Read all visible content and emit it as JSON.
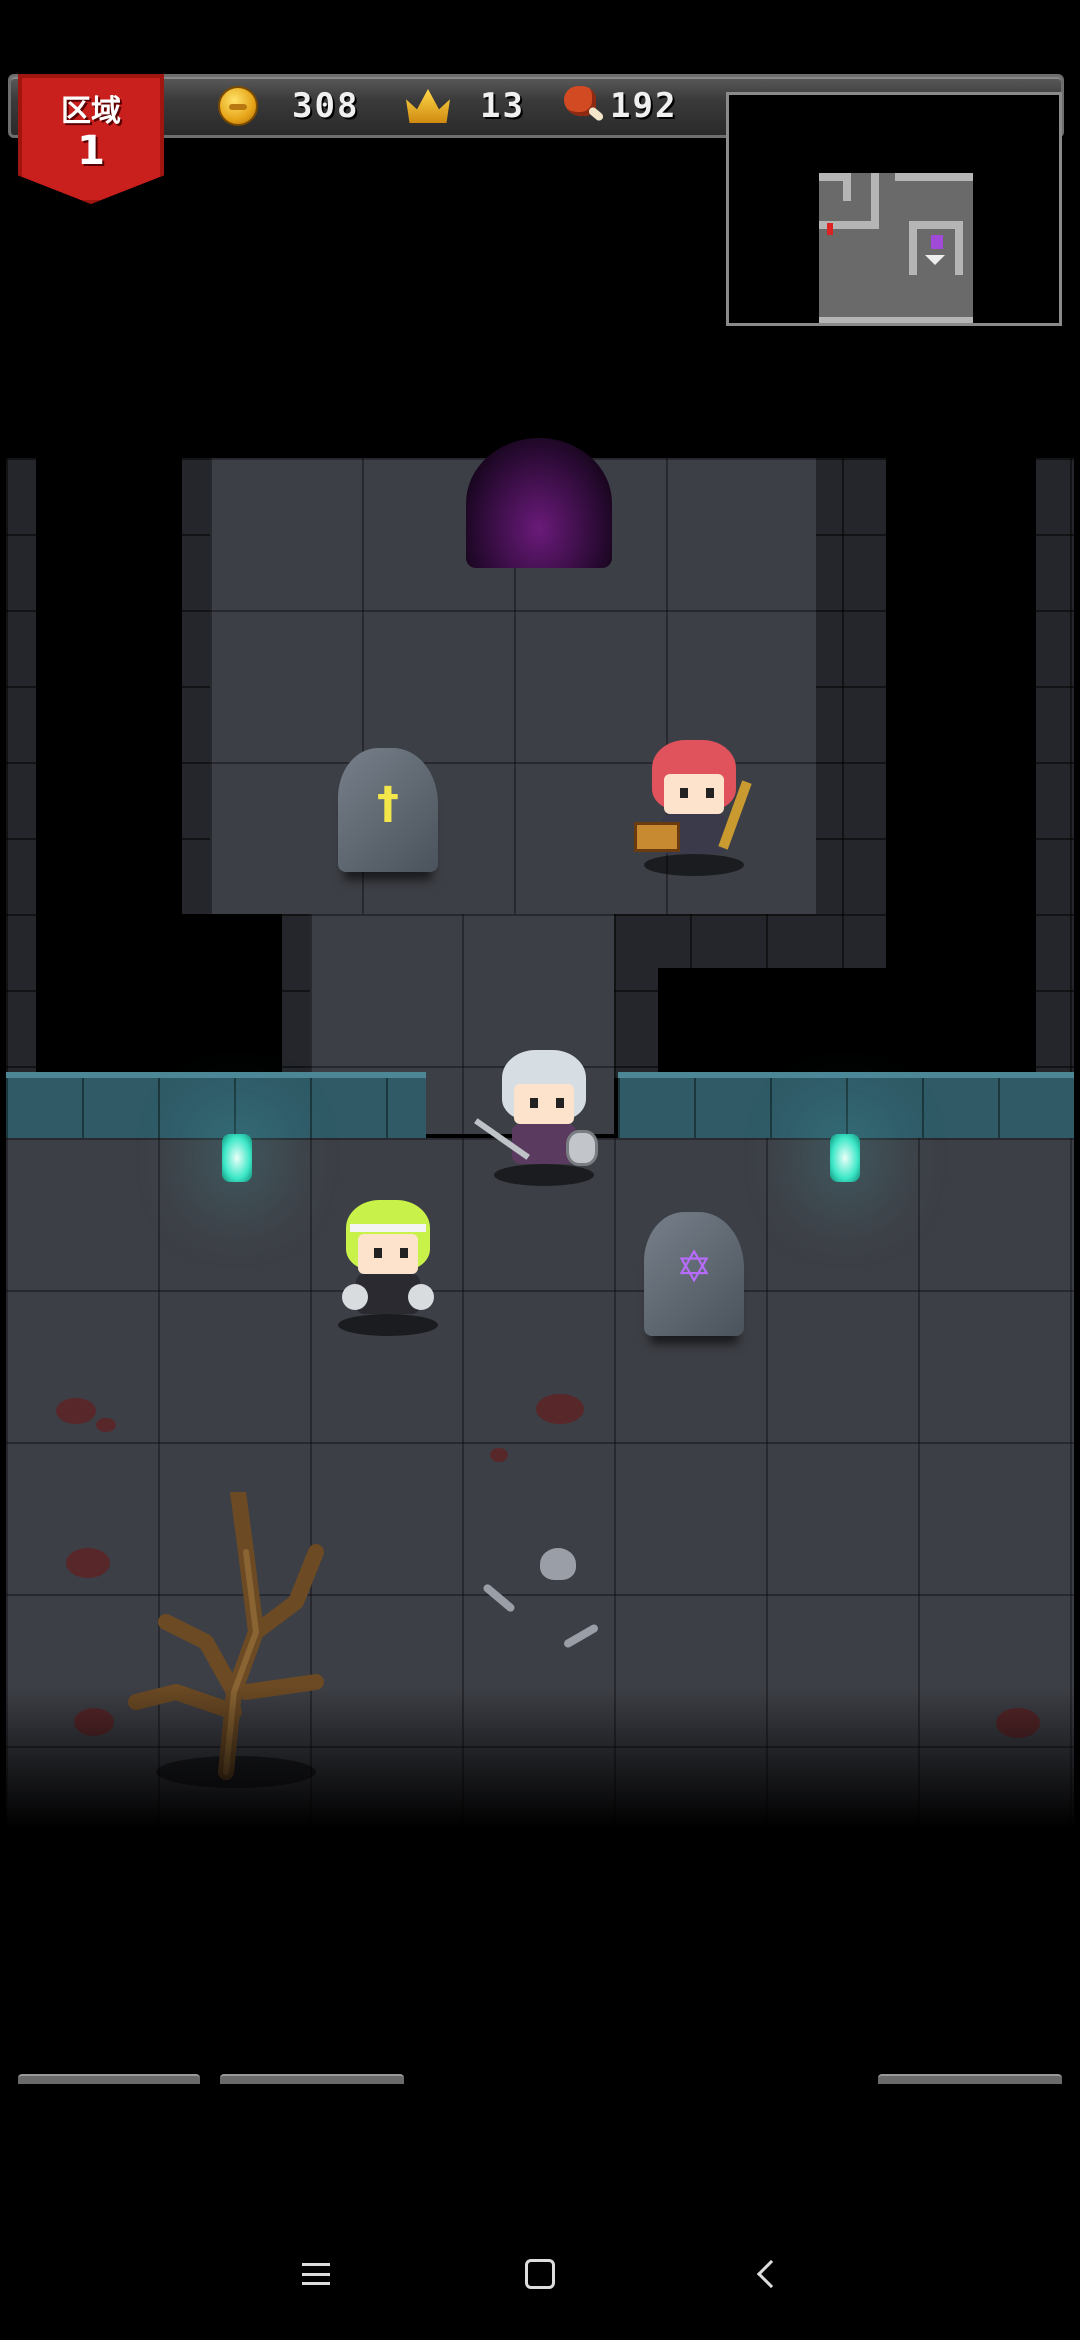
{
  "hud": {
    "zone_label": "区域",
    "zone_number": "1",
    "coins": "308",
    "crowns": "13",
    "food": "192"
  },
  "icons": {
    "coin": "coin-icon",
    "crown": "crown-icon",
    "food": "meat-icon"
  },
  "tombstones": [
    {
      "symbol": "†",
      "symbol_color": "#f2e64a"
    },
    {
      "symbol": "✡",
      "symbol_color": "#b86bff"
    }
  ],
  "colors": {
    "zone_banner": "#c9201e",
    "floor": "#3d3f46",
    "teal_wall": "#2f5a66",
    "lantern": "#3ee8c8",
    "portal": "#6a1a7a"
  }
}
